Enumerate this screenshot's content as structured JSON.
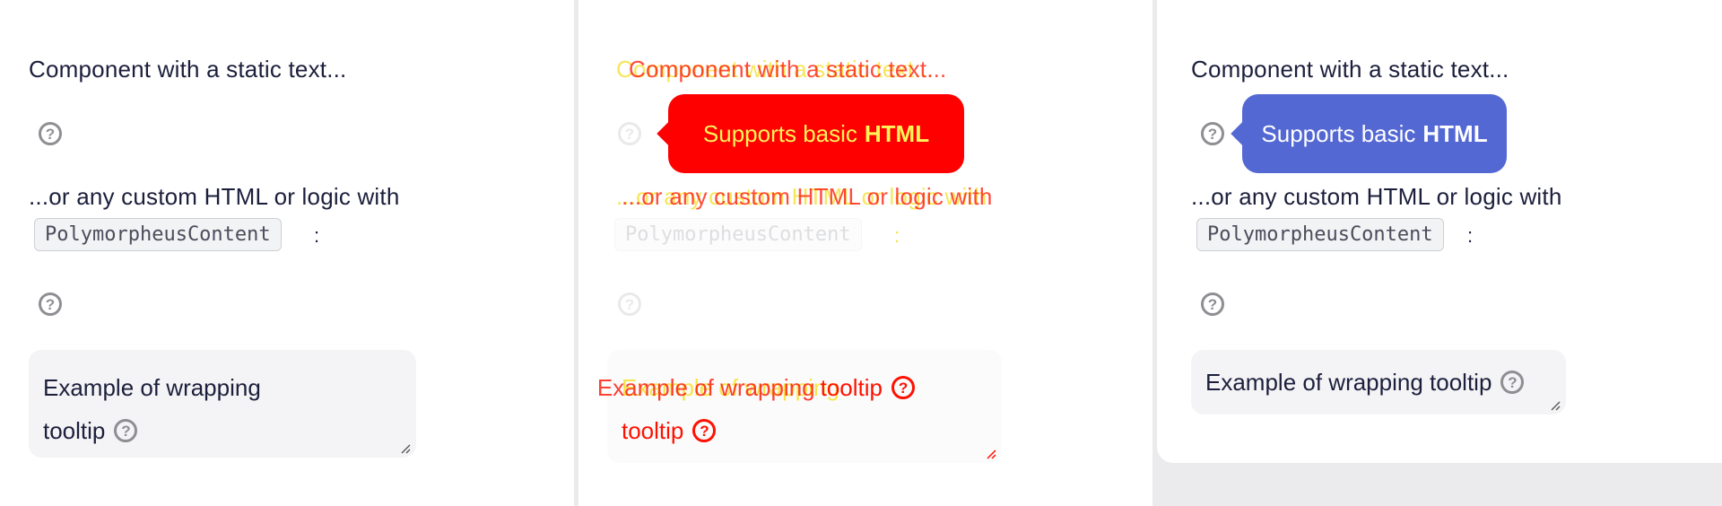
{
  "panels": {
    "left": {
      "static_text": "Component with a static text...",
      "custom_text": "...or any custom HTML or logic with",
      "code_chip": "PolymorpheusContent",
      "colon": ":",
      "wrap_line1": "Example of wrapping",
      "wrap_line2": "tooltip"
    },
    "middle": {
      "static_text": "Component with a static text...",
      "custom_text": "...or any custom HTML or logic with",
      "code_chip": "PolymorpheusContent",
      "colon": ":",
      "wrap_line1": "Example of wrapping",
      "wrap_line1_overlay": "tooltip",
      "wrap_line2": "tooltip",
      "tooltip_plain": "Supports basic",
      "tooltip_bold": "HTML",
      "tooltip_color": "#ff0000",
      "tooltip_text_color": "#fff45a"
    },
    "right": {
      "static_text": "Component with a static text...",
      "custom_text": "...or any custom HTML or logic with",
      "code_chip": "PolymorpheusContent",
      "colon": ":",
      "wrap_line1": "Example of wrapping tooltip",
      "tooltip_plain": "Supports basic",
      "tooltip_bold": "HTML",
      "tooltip_color": "#5468d4"
    }
  },
  "icons": {
    "help": "?"
  }
}
